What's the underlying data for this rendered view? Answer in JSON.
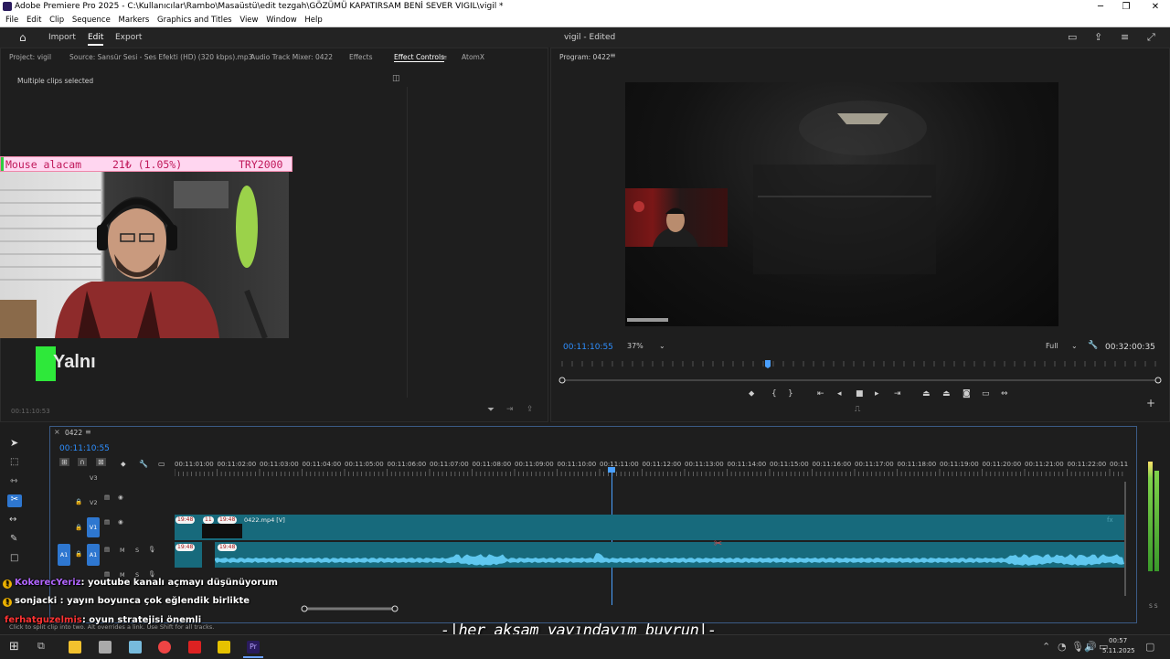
{
  "titlebar": {
    "title": "Adobe Premiere Pro 2025 - C:\\Kullanıcılar\\Rambo\\Masaüstü\\edit tezgah\\GÖZÜMÜ KAPATIRSAM BENİ SEVER VIGIL\\vigil *"
  },
  "menu": [
    "File",
    "Edit",
    "Clip",
    "Sequence",
    "Markers",
    "Graphics and Titles",
    "View",
    "Window",
    "Help"
  ],
  "header": {
    "import": "Import",
    "edit": "Edit",
    "export": "Export",
    "project_title": "vigil - Edited"
  },
  "source_panel": {
    "tabs": [
      "Project: vigil",
      "Source: Sansür Sesi - Ses Efekti (HD) (320 kbps).mp3",
      "Audio Track Mixer: 0422",
      "Effects",
      "Effect Controls",
      "AtomX"
    ],
    "active_tab": "Effect Controls",
    "status": "Multiple clips selected",
    "timecode": "00:11:10:53"
  },
  "overlay": {
    "donation": {
      "name": "Mouse alacam",
      "amount": "21₺ (1.05%)",
      "goal": "TRY2000"
    },
    "logo_text": "Yalnı"
  },
  "program_panel": {
    "title": "Program: 0422",
    "timecode": "00:11:10:55",
    "zoom": "37%",
    "resolution": "Full",
    "duration": "00:32:00:35"
  },
  "timeline": {
    "sequence": "0422",
    "timecode": "00:11:10:55",
    "ruler": [
      "00:11:01:00",
      "00:11:02:00",
      "00:11:03:00",
      "00:11:04:00",
      "00:11:05:00",
      "00:11:06:00",
      "00:11:07:00",
      "00:11:08:00",
      "00:11:09:00",
      "00:11:10:00",
      "00:11:11:00",
      "00:11:12:00",
      "00:11:13:00",
      "00:11:14:00",
      "00:11:15:00",
      "00:11:16:00",
      "00:11:17:00",
      "00:11:18:00",
      "00:11:19:00",
      "00:11:20:00",
      "00:11:21:00",
      "00:11:22:00",
      "00:11"
    ],
    "tracks": {
      "v3": "V3",
      "v2": "V2",
      "v1": "V1",
      "a1": "A1",
      "m": "M",
      "s": "S"
    },
    "clip_label": "0422.mp4 [V]",
    "badge": "19:48",
    "badge_short": "11"
  },
  "chat": [
    {
      "user": "KokerecYeriz",
      "message": ": youtube kanalı açmayı düşünüyorum",
      "user_color": "#b266ff"
    },
    {
      "user": "sonjacki",
      "message": " : yayın boyunca çok eğlendik birlikte",
      "user_color": "#ffffff"
    },
    {
      "user": "ferhatguzelmis",
      "message": ": oyun stratejisi önemli",
      "user_color": "#ff3333"
    }
  ],
  "status_hint": "Click to split clip into two. Alt overrides a link. Use Shift for all tracks.",
  "subtitle": "-|her akşam yayındayım buyrun|-",
  "taskbar": {
    "time": "00:57",
    "date": "5.11.2025"
  },
  "meters": {
    "labels": "S S"
  }
}
